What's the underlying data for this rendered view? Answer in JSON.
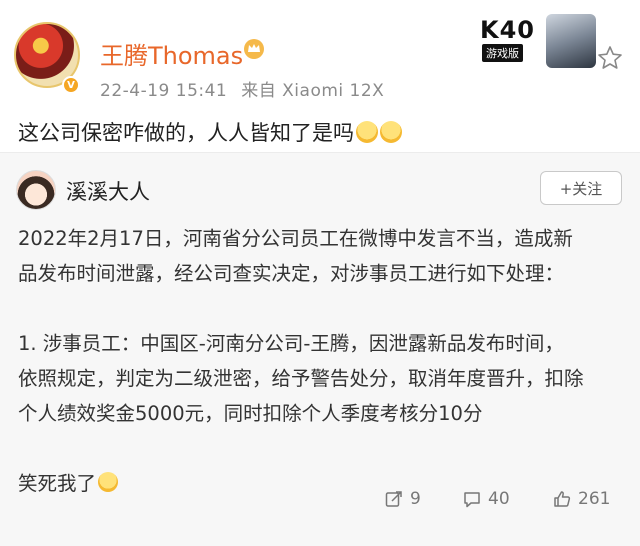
{
  "post": {
    "username": "王腾Thomas",
    "date": "22-4-19 15:41",
    "source": "来自 Xiaomi 12X",
    "text": "这公司保密咋做的，人人皆知了是吗",
    "promo": {
      "title": "K40",
      "subtitle": "游戏版"
    }
  },
  "repost": {
    "username": "溪溪大人",
    "follow_label": "+关注",
    "lines": [
      "2022年2月17日，河南省分公司员工在微博中发言不当，造成新",
      "品发布时间泄露，经公司查实决定，对涉事员工进行如下处理：",
      "1. 涉事员工：中国区-河南分公司-王腾，因泄露新品发布时间，",
      "依照规定，判定为二级泄密，给予警告处分，取消年度晋升，扣除",
      "个人绩效奖金5000元，同时扣除个人季度考核分10分",
      "笑死我了"
    ],
    "actions": {
      "repost_count": "9",
      "comment_count": "40",
      "like_count": "261"
    }
  },
  "icons": {
    "vip": "crown-badge-icon",
    "star": "star-outline-icon",
    "repost": "repost-icon",
    "comment": "comment-icon",
    "like": "thumbs-up-icon"
  },
  "colors": {
    "username": "#e8672a",
    "repost_background": "#f7f7f7"
  }
}
